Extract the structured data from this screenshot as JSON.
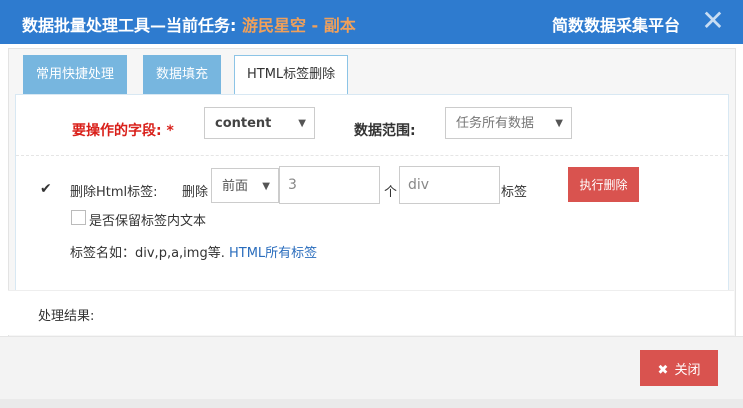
{
  "title": {
    "prefix": "数据批量处理工具—当前任务: ",
    "task": "游民星空 - 副本",
    "platform": "简数数据采集平台"
  },
  "tabs": [
    "常用快捷处理",
    "数据填充",
    "HTML标签删除"
  ],
  "form": {
    "field_label": "要操作的字段: *",
    "field_value": "content",
    "range_label": "数据范围:",
    "range_value": "任务所有数据"
  },
  "delete": {
    "label": "删除Html标签:",
    "action": "删除",
    "position": "前面",
    "count": "3",
    "unit": "个",
    "tag": "div",
    "tag_label": "标签",
    "execute": "执行删除",
    "keep_text": "是否保留标签内文本",
    "example_prefix": "标签名如：div,p,a,img等.",
    "example_link": "HTML所有标签"
  },
  "result_label": "处理结果:",
  "close_label": "关闭",
  "colors": {
    "titlebar": "#2e7bcf",
    "task": "#f0a05a",
    "tab": "#77b6df",
    "danger": "#d9534f",
    "required": "#d9201a"
  }
}
